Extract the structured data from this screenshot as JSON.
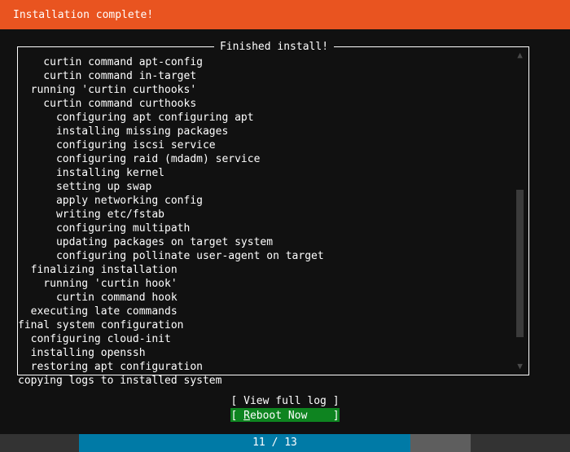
{
  "header": {
    "title": "Installation complete!",
    "bg_color": "#e95420",
    "text_color": "#ffffff"
  },
  "logbox": {
    "title": "Finished install!",
    "border_color": "#ffffff",
    "lines": [
      "    curtin command apt-config",
      "    curtin command in-target",
      "  running 'curtin curthooks'",
      "    curtin command curthooks",
      "      configuring apt configuring apt",
      "      installing missing packages",
      "      configuring iscsi service",
      "      configuring raid (mdadm) service",
      "      installing kernel",
      "      setting up swap",
      "      apply networking config",
      "      writing etc/fstab",
      "      configuring multipath",
      "      updating packages on target system",
      "      configuring pollinate user-agent on target",
      "  finalizing installation",
      "    running 'curtin hook'",
      "      curtin command hook",
      "  executing late commands",
      "final system configuration",
      "  configuring cloud-init",
      "  installing openssh",
      "  restoring apt configuration",
      "copying logs to installed system"
    ],
    "scrollbar": {
      "up_arrow": "▲",
      "down_arrow": "▼",
      "thumb_color": "#3b3b3b",
      "arrow_color": "#4a4a4a"
    }
  },
  "buttons": [
    {
      "label": "[ View full log ]",
      "name": "view-full-log-button",
      "selected": false
    },
    {
      "label_prefix": "[ ",
      "accel": "R",
      "label_rest": "eboot Now    ]",
      "full_label": "[ Reboot Now    ]",
      "name": "reboot-now-button",
      "selected": true,
      "highlight_color": "#0e8420"
    }
  ],
  "progress": {
    "label": "11 / 13",
    "current": 11,
    "total": 13,
    "percent": 84.6,
    "fill_color": "#007aa6",
    "track_color": "#5e5e5e",
    "bg_color": "#333333"
  }
}
